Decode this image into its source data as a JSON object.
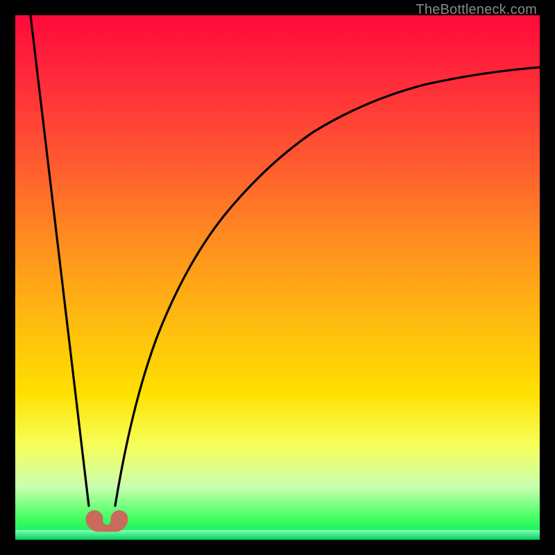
{
  "watermark": {
    "text": "TheBottleneck.com"
  },
  "chart_data": {
    "type": "line",
    "title": "",
    "xlabel": "",
    "ylabel": "",
    "xlim": [
      0,
      100
    ],
    "ylim": [
      0,
      100
    ],
    "background_gradient": {
      "stops": [
        {
          "pos": 0.0,
          "color": "#ff0a3a"
        },
        {
          "pos": 0.12,
          "color": "#ff2a3a"
        },
        {
          "pos": 0.28,
          "color": "#ff5a30"
        },
        {
          "pos": 0.42,
          "color": "#ff8a20"
        },
        {
          "pos": 0.58,
          "color": "#ffba10"
        },
        {
          "pos": 0.72,
          "color": "#ffe000"
        },
        {
          "pos": 0.82,
          "color": "#f6ff5a"
        },
        {
          "pos": 0.9,
          "color": "#c8ffb0"
        },
        {
          "pos": 0.96,
          "color": "#40ff60"
        },
        {
          "pos": 1.0,
          "color": "#00e868"
        }
      ]
    },
    "series": [
      {
        "name": "left-line",
        "x": [
          3.0,
          14.0
        ],
        "y": [
          100.0,
          6.5
        ]
      },
      {
        "name": "right-curve",
        "x": [
          19,
          22,
          25,
          28,
          32,
          36,
          40,
          45,
          50,
          55,
          60,
          66,
          72,
          80,
          90,
          100
        ],
        "y": [
          6.5,
          19,
          30,
          39,
          48,
          55,
          61,
          66.5,
          71,
          74.5,
          77.5,
          80.5,
          83,
          85.5,
          88,
          90
        ]
      }
    ],
    "marker": {
      "name": "min-marker",
      "shape": "rounded-blob",
      "color": "#c96a5c",
      "x_range": [
        13.0,
        20.0
      ],
      "y": 5.0
    }
  }
}
